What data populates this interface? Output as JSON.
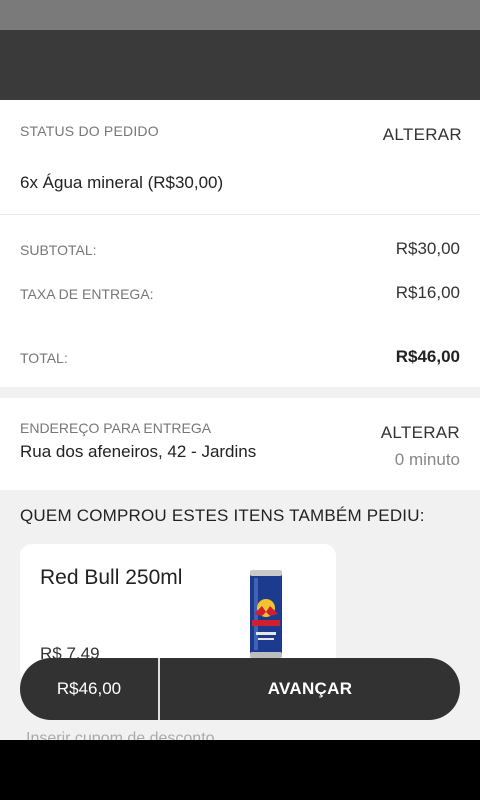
{
  "order": {
    "status_label": "STATUS DO PEDIDO",
    "edit_label": "ALTERAR",
    "item": "6x Água mineral (R$30,00)"
  },
  "totals": {
    "subtotal_label": "SUBTOTAL:",
    "subtotal_value": "R$30,00",
    "delivery_label": "TAXA DE ENTREGA:",
    "delivery_value": "R$16,00",
    "total_label": "TOTAL:",
    "total_value": "R$46,00"
  },
  "address": {
    "label": "ENDEREÇO PARA ENTREGA",
    "value": "Rua dos afeneiros, 42 - Jardins",
    "edit_label": "ALTERAR",
    "time": "0 minuto"
  },
  "suggestions": {
    "title": "QUEM COMPROU ESTES ITENS TAMBÉM PEDIU:",
    "product": {
      "name": "Red Bull 250ml",
      "price": "R$ 7,49",
      "image_icon": "redbull-can-icon"
    }
  },
  "cta": {
    "total": "R$46,00",
    "next_label": "AVANÇAR"
  },
  "coupon": {
    "label": "Inserir cupom de desconto"
  },
  "colors": {
    "app_bar": "#3a3a3a",
    "cta_bg": "#323232",
    "background": "#f1f1f1"
  }
}
